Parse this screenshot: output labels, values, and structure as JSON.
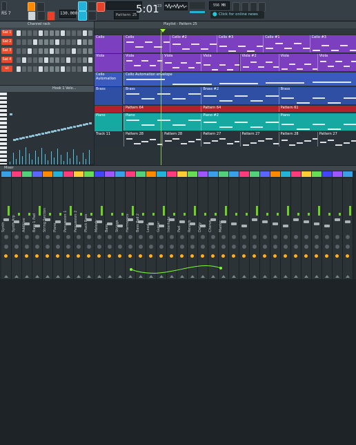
{
  "toolbar": {
    "pattern_mode": "PAT",
    "song_mode": "SONG",
    "tempo": "130.000",
    "time_main": "5:01",
    "time_sub": "23",
    "pattern_select": "Pattern 25",
    "news_text": "Click for online news",
    "cpu": "556 MB",
    "win_label": "RS 7"
  },
  "rack": {
    "title": "Channel rack",
    "channels": [
      {
        "name": "Sat 1",
        "color": "#e94a2d"
      },
      {
        "name": "Sat 2",
        "color": "#e94a2d"
      },
      {
        "name": "Sat 3",
        "color": "#e94a2d"
      },
      {
        "name": "Sat 4",
        "color": "#e94a2d"
      },
      {
        "name": "ut",
        "color": "#e94a2d"
      }
    ]
  },
  "piano": {
    "title": "Hook 1 Velo..."
  },
  "playlist": {
    "title": "Playlist - Pattern 25",
    "tracks": [
      {
        "name": "Cello",
        "color": "#7b3fbf",
        "clips": [
          "Cello",
          "Cello #2",
          "Cello #3",
          "Cello #1",
          "Cello #3"
        ]
      },
      {
        "name": "Viola",
        "color": "#7b3fbf",
        "clips": [
          "Viola",
          "Viola",
          "Viola",
          "Viola #2",
          "Viola",
          "Viola"
        ]
      },
      {
        "name": "Cello Automation",
        "color": "#3a5bbd",
        "clips": [
          "Cello Automation envelope"
        ]
      },
      {
        "name": "Brass",
        "color": "#2f4fa5",
        "clips": [
          "Brass",
          "Brass #2",
          "Brass"
        ]
      },
      {
        "name": "",
        "color": "#b6202c",
        "clips": [
          "Pattern 64",
          "Pattern 64",
          "Pattern 61"
        ]
      },
      {
        "name": "Piano",
        "color": "#16a9a1",
        "clips": [
          "Piano",
          "Piano #2",
          "Piano"
        ]
      },
      {
        "name": "Track 11",
        "color": "#283238",
        "clips": [
          "Pattern 28",
          "Pattern 28",
          "Pattern 27",
          "Pattern 27",
          "Pattern 28",
          "Pattern 27"
        ]
      }
    ]
  },
  "mixer": {
    "title": "Mixer",
    "strips": [
      "Synth",
      "Synth Arp",
      "Additive",
      "Bass 1 Pad",
      "String Section",
      "Piano",
      "Percussion 1",
      "Percussion 2",
      "Pluck Bass",
      "Melody",
      "Bass",
      "Strings",
      "Harmonics",
      "Bass Pad 2",
      "Lead",
      "Guitar",
      "Interlude",
      "Pad",
      "Reverb",
      "Delay",
      "Chorus",
      "Master"
    ],
    "colors": [
      "#39a0e8",
      "#ff3c7b",
      "#52d07a",
      "#5a66ff",
      "#ff8a00",
      "#23b3d9",
      "#ff3c7b",
      "#ffcc33",
      "#66dd55",
      "#4444ff",
      "#9f55ff",
      "#39a0e8",
      "#ff3c7b",
      "#52d07a",
      "#ff8a00",
      "#23b3d9",
      "#ff3c7b",
      "#ffcc33",
      "#66dd55",
      "#9f55ff",
      "#39a0e8",
      "#52d07a"
    ]
  }
}
